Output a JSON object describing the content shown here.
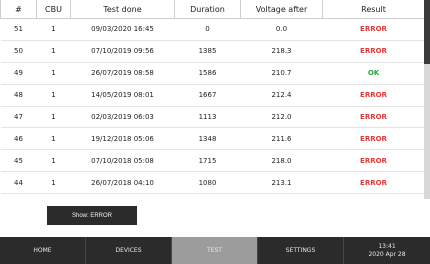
{
  "table": {
    "headers": [
      "#",
      "CBU",
      "Test done",
      "Duration",
      "Voltage after",
      "Result"
    ],
    "rows": [
      [
        "51",
        "1",
        "09/03/2020 16:45",
        "0",
        "0.0",
        "ERROR"
      ],
      [
        "50",
        "1",
        "07/10/2019 09:56",
        "1385",
        "218.3",
        "ERROR"
      ],
      [
        "49",
        "1",
        "26/07/2019 08:58",
        "1586",
        "210.7",
        "OK"
      ],
      [
        "48",
        "1",
        "14/05/2019 08:01",
        "1667",
        "212.4",
        "ERROR"
      ],
      [
        "47",
        "1",
        "02/03/2019 06:03",
        "1113",
        "212.0",
        "ERROR"
      ],
      [
        "46",
        "1",
        "19/12/2018 05:06",
        "1348",
        "211.6",
        "ERROR"
      ],
      [
        "45",
        "1",
        "07/10/2018 05:08",
        "1715",
        "218.0",
        "ERROR"
      ],
      [
        "44",
        "1",
        "26/07/2018 04:10",
        "1080",
        "213.1",
        "ERROR"
      ]
    ]
  },
  "filter_button": {
    "label": "Show: ERROR"
  },
  "nav": {
    "items": [
      "HOME",
      "DEVICES",
      "TEST",
      "SETTINGS"
    ],
    "active": "TEST",
    "clock_time": "13:41",
    "clock_date": "2020 Apr 28"
  },
  "colors": {
    "error": "#e23b3b",
    "ok": "#2aa53a",
    "nav_bg": "#2b2b2b",
    "nav_active": "#9c9c9c"
  }
}
